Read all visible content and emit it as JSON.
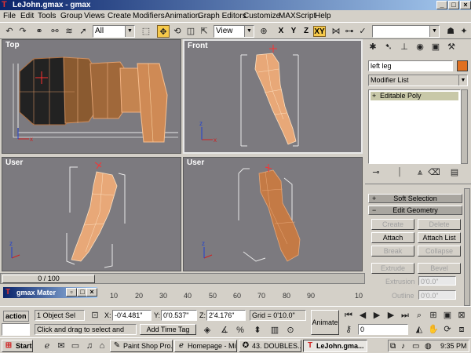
{
  "window": {
    "title": "LeJohn.gmax - gmax",
    "min": "_",
    "max": "□",
    "close": "×"
  },
  "menu": [
    "File",
    "Edit",
    "Tools",
    "Group",
    "Views",
    "Create",
    "Modifiers",
    "Animation",
    "Graph Editors",
    "Customize",
    "MAXScript",
    "Help"
  ],
  "toolbar": {
    "selection_filter": "All",
    "ref_coord": "View",
    "axis_x": "X",
    "axis_y": "Y",
    "axis_z": "Z",
    "axis_xy": "XY",
    "named_sel": ""
  },
  "viewports": {
    "top": {
      "label": "Top"
    },
    "front": {
      "label": "Front"
    },
    "user1": {
      "label": "User"
    },
    "user2": {
      "label": "User"
    },
    "axis_x": "x",
    "axis_y": "y",
    "axis_z": "z"
  },
  "panel": {
    "object_name": "left leg",
    "object_color": "#e07020",
    "modifier_list": "Modifier List",
    "stack_item": "Editable Poly",
    "rollout_soft": "Soft Selection",
    "rollout_geom": "Edit Geometry",
    "btn_create": "Create",
    "btn_delete": "Delete",
    "btn_attach": "Attach",
    "btn_attach_list": "Attach List",
    "btn_break": "Break",
    "btn_collapse": "Collapse",
    "btn_extrude": "Extrude",
    "btn_bevel": "Bevel",
    "extrusion_label": "Extrusion",
    "extrusion_value": "0'0.0\"",
    "outline_label": "Outline",
    "outline_value": "0'0.0\""
  },
  "timeline": {
    "slider": "0 / 100",
    "ticks": [
      "10",
      "20",
      "30",
      "40",
      "50",
      "60",
      "70",
      "80",
      "90",
      "10"
    ],
    "material_window": "gmax Mater"
  },
  "status": {
    "mode": "action",
    "selected": "1 Object Sel",
    "x_label": "X:",
    "x_value": "-0'4.481\"",
    "y_label": "Y:",
    "y_value": "0'0.537\"",
    "z_label": "Z:",
    "z_value": "2'4.176\"",
    "grid": "Grid = 0'10.0\"",
    "prompt": "Click and drag to select and move o",
    "add_time_tag": "Add Time Tag",
    "animate": "Animate",
    "frame": "0"
  },
  "taskbar": {
    "start": "Start",
    "tasks": [
      "Paint Shop Pro...",
      "Homepage - Mi...",
      "43. DOUBLES...",
      "LeJohn.gma..."
    ],
    "clock": "9:35 PM"
  },
  "colors": {
    "accent": "#0a246a",
    "viewport_bg": "#7c7a7f",
    "leg_skin": "#e5a070"
  }
}
